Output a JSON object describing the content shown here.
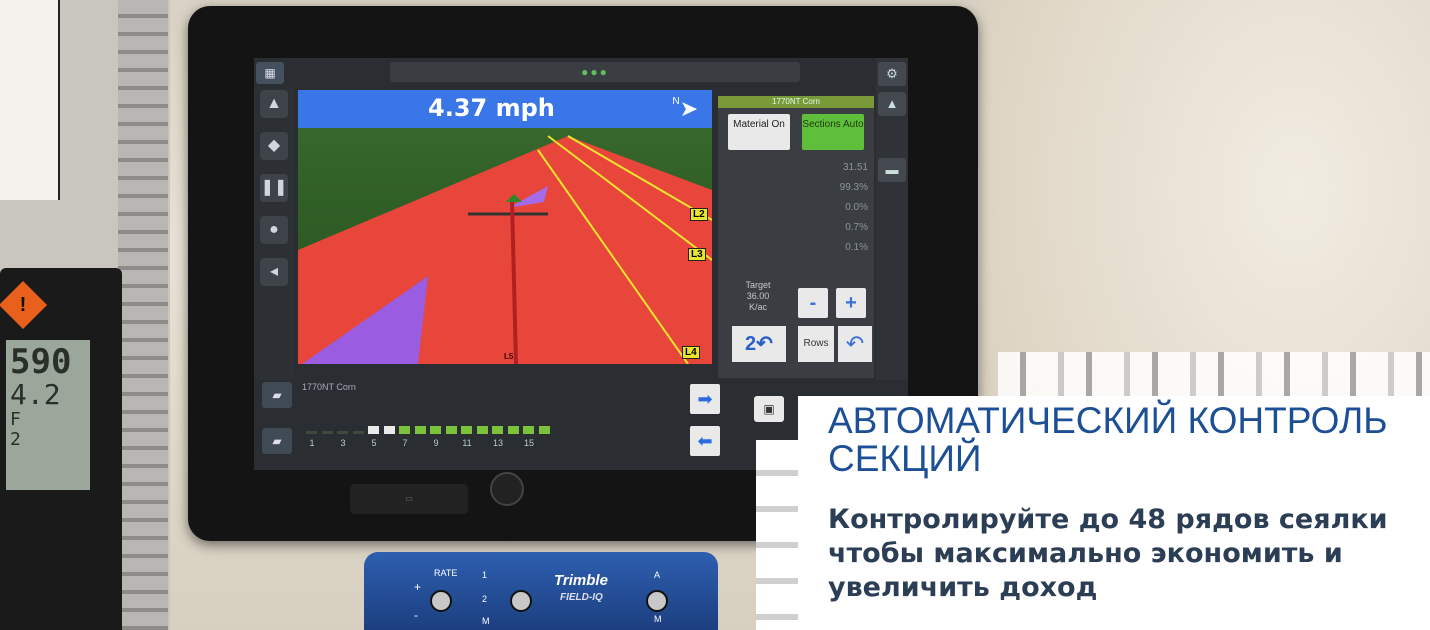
{
  "navigation": {
    "speed": "4.37 mph",
    "compass_label": "N",
    "guidance_labels": [
      "L2",
      "L3",
      "L4",
      "L5"
    ]
  },
  "control_panel": {
    "header": "1770NT Corn",
    "material_button": "Material On",
    "sections_button": "Sections Auto",
    "values": [
      {
        "label": "",
        "value": "31.51"
      },
      {
        "label": "",
        "value": "99.3%"
      },
      {
        "label": "",
        "value": "0.0%"
      },
      {
        "label": "",
        "value": "0.7%"
      },
      {
        "label": "",
        "value": "0.1%"
      }
    ],
    "target_label": "Target",
    "target_value": "36.00",
    "target_unit": "K/ac",
    "minus_button": "-",
    "plus_button": "+",
    "rows_button": "Rows",
    "row_count": "2"
  },
  "section_bar": {
    "planter_name": "1770NT Corn",
    "section_numbers": [
      "1",
      "3",
      "5",
      "7",
      "9",
      "11",
      "13",
      "15"
    ],
    "section_states": [
      "off",
      "off",
      "off",
      "off",
      "white",
      "white",
      "on",
      "on",
      "on",
      "on",
      "on",
      "on",
      "on",
      "on",
      "on",
      "on"
    ]
  },
  "switch_box": {
    "brand": "Trimble",
    "product": "FIELD-IQ",
    "rate_label": "RATE",
    "label_a": "A",
    "label_m": "M",
    "plus": "+",
    "minus": "-",
    "num_1": "1",
    "num_2": "2",
    "num_m": "M"
  },
  "left_display": {
    "line1": "590",
    "line2": "4.2",
    "line3": "F",
    "line4": "2"
  },
  "overlay": {
    "title": "АВТОМАТИЧЕСКИЙ КОНТРОЛЬ СЕКЦИЙ",
    "body": "Контролируйте до 48 рядов сеялки чтобы максимально экономить и увеличить доход"
  },
  "colors": {
    "speed_bar": "#3a76e8",
    "field_coverage": "#e8463a",
    "section_on": "#7cc23a",
    "title_blue": "#1d4f96"
  }
}
